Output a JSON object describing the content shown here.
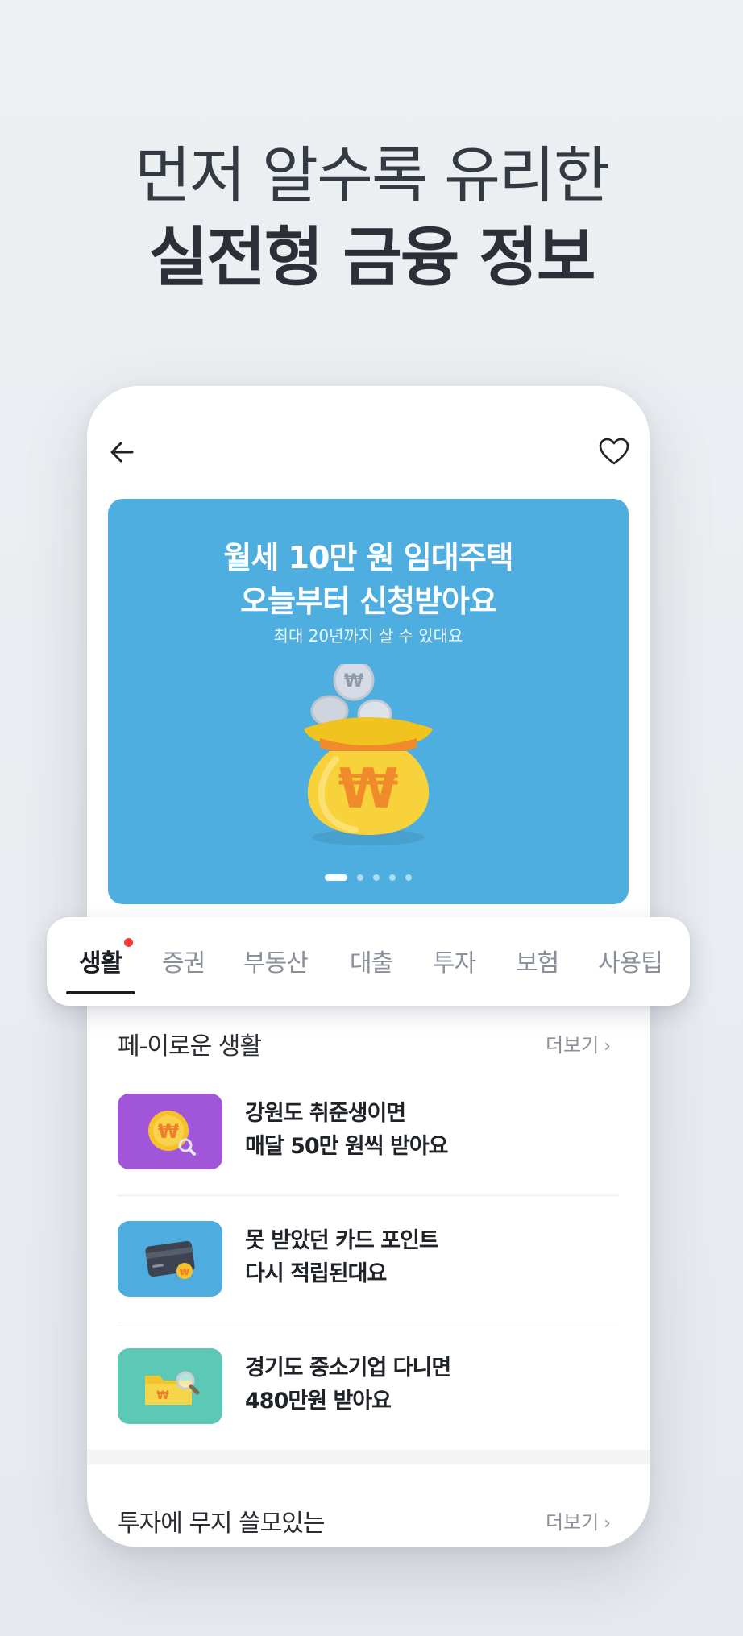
{
  "hero": {
    "line1": "먼저 알수록 유리한",
    "line2": "실전형 금융 정보"
  },
  "topbar": {
    "back_icon": "arrow-left-icon",
    "favorite_icon": "heart-outline-icon"
  },
  "banner": {
    "title_line1": "월세 10만 원 임대주택",
    "title_line2": "오늘부터 신청받아요",
    "subtitle": "최대 20년까지 살 수 있대요",
    "illustration": "money-bag-icon",
    "page_total": 5,
    "page_current": 1
  },
  "tabs": [
    {
      "label": "생활",
      "active": true,
      "has_badge": true
    },
    {
      "label": "증권"
    },
    {
      "label": "부동산"
    },
    {
      "label": "대출"
    },
    {
      "label": "투자"
    },
    {
      "label": "보험"
    },
    {
      "label": "사용팁"
    }
  ],
  "section1": {
    "title": "페-이로운 생활",
    "more": "더보기",
    "items": [
      {
        "line1": "강원도 취준생이면",
        "line2": "매달 50만 원씩 받아요",
        "thumb_color": "#a155d9",
        "icon": "coin-search-icon"
      },
      {
        "line1": "못 받았던 카드 포인트",
        "line2": "다시 적립된대요",
        "thumb_color": "#4facde",
        "icon": "card-coin-icon"
      },
      {
        "line1": "경기도 중소기업 다니면",
        "line2": "480만원 받아요",
        "thumb_color": "#5cc8b6",
        "icon": "folder-search-icon"
      }
    ]
  },
  "section2": {
    "title": "투자에 무지 쓸모있는",
    "more": "더보기"
  },
  "colors": {
    "background": "#eceff2",
    "banner": "#4faee0",
    "badge": "#ef3f3f"
  }
}
